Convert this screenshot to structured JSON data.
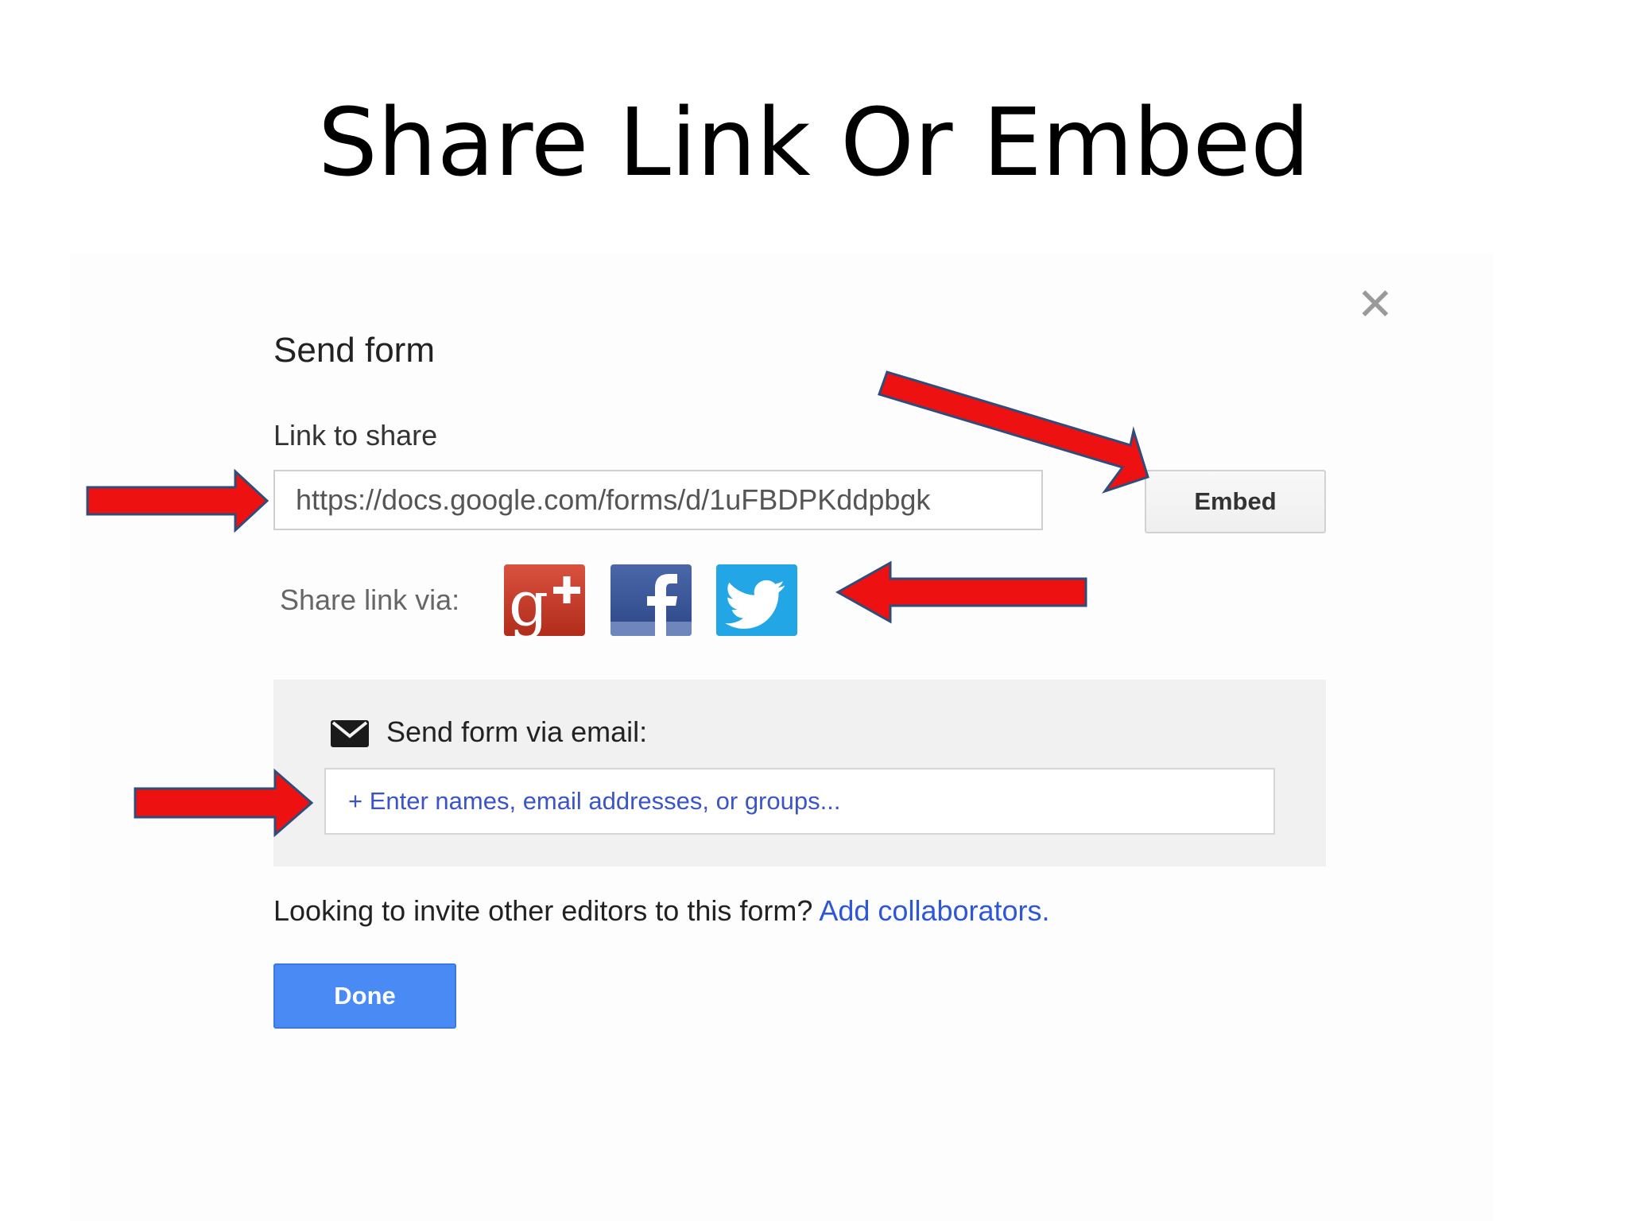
{
  "slide": {
    "title": "Share Link Or Embed"
  },
  "dialog": {
    "title": "Send form",
    "close_glyph": "✕",
    "link_label": "Link to share",
    "link_value": "https://docs.google.com/forms/d/1uFBDPKddpbgk",
    "embed_label": "Embed",
    "share_via_label": "Share link via:",
    "social": [
      {
        "name": "google-plus",
        "glyph": "g+"
      },
      {
        "name": "facebook",
        "glyph": "f"
      },
      {
        "name": "twitter",
        "glyph": "bird"
      }
    ],
    "email": {
      "label": "Send form via email:",
      "placeholder": "+ Enter names, email addresses, or groups..."
    },
    "invite_text": "Looking to invite other editors to this form?",
    "collaborators_link": "Add collaborators.",
    "done_label": "Done"
  },
  "colors": {
    "annotation_arrow": "#ee1111",
    "arrow_outline": "#2f4d7a",
    "done_button": "#4a8af4",
    "link_blue": "#2d56d9",
    "twitter": "#22a6e6",
    "facebook": "#3b5998",
    "google_plus": "#d34836"
  },
  "annotations": {
    "arrow_count": 4
  }
}
